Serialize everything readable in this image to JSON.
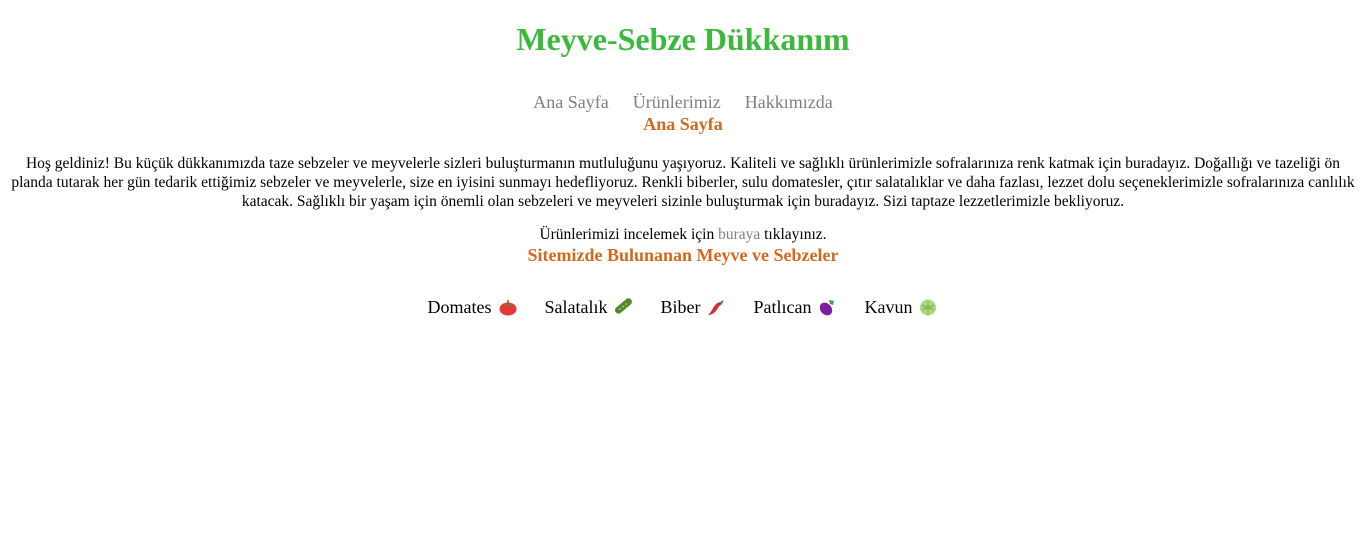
{
  "header": {
    "title": "Meyve-Sebze Dükkanım"
  },
  "nav": {
    "items": [
      {
        "label": "Ana Sayfa"
      },
      {
        "label": "Ürünlerimiz"
      },
      {
        "label": "Hakkımızda"
      }
    ]
  },
  "home": {
    "heading": "Ana Sayfa",
    "intro": "Hoş geldiniz! Bu küçük dükkanımızda taze sebzeler ve meyvelerle sizleri buluşturmanın mutluluğunu yaşıyoruz. Kaliteli ve sağlıklı ürünlerimizle sofralarınıza renk katmak için buradayız. Doğallığı ve tazeliği ön planda tutarak her gün tedarik ettiğimiz sebzeler ve meyvelerle, size en iyisini sunmayı hedefliyoruz. Renkli biberler, sulu domatesler, çıtır salatalıklar ve daha fazlası, lezzet dolu seçeneklerimizle sofralarınıza canlılık katacak. Sağlıklı bir yaşam için önemli olan sebzeleri ve meyveleri sizinle buluşturmak için buradayız. Sizi taptaze lezzetlerimizle bekliyoruz.",
    "cta_before": "Ürünlerimizi incelemek için ",
    "cta_link": "buraya",
    "cta_after": " tıklayınız."
  },
  "products": {
    "heading": "Sitemizde Bulunanan Meyve ve Sebzeler",
    "items": [
      {
        "name": "Domates",
        "icon": "tomato-icon"
      },
      {
        "name": "Salatalık",
        "icon": "cucumber-icon"
      },
      {
        "name": "Biber",
        "icon": "hot-pepper-icon"
      },
      {
        "name": "Patlıcan",
        "icon": "eggplant-icon"
      },
      {
        "name": "Kavun",
        "icon": "melon-icon"
      }
    ]
  },
  "colors": {
    "title": "#3cb93c",
    "heading": "#d2691e",
    "link": "#808080"
  }
}
